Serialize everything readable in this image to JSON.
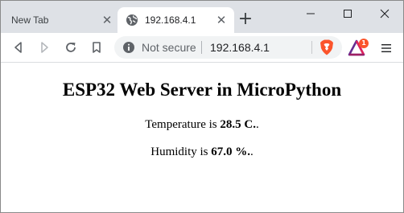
{
  "tabs": [
    {
      "title": "New Tab",
      "active": false
    },
    {
      "title": "192.168.4.1",
      "active": true
    }
  ],
  "toolbar": {
    "security_label": "Not secure",
    "url": "192.168.4.1",
    "rewards_badge": "1"
  },
  "page": {
    "heading": "ESP32 Web Server in MicroPython",
    "temperature": {
      "prefix": "Temperature is ",
      "value": "28.5 C.",
      "suffix": "."
    },
    "humidity": {
      "prefix": "Humidity is ",
      "value": "67.0 %.",
      "suffix": "."
    }
  },
  "colors": {
    "tabstrip_bg": "#dee1e6",
    "omnibox_bg": "#f1f3f4",
    "brave_orange": "#fb542b",
    "rewards_purple": "#662d91"
  },
  "icons": {
    "window": [
      "minimize-icon",
      "maximize-icon",
      "close-icon"
    ],
    "nav": [
      "back-arrow-icon",
      "forward-arrow-icon",
      "reload-icon",
      "bookmark-icon"
    ],
    "omnibox": [
      "info-icon",
      "brave-shield-icon"
    ],
    "toolbar": [
      "brave-rewards-icon",
      "hamburger-menu-icon"
    ]
  }
}
